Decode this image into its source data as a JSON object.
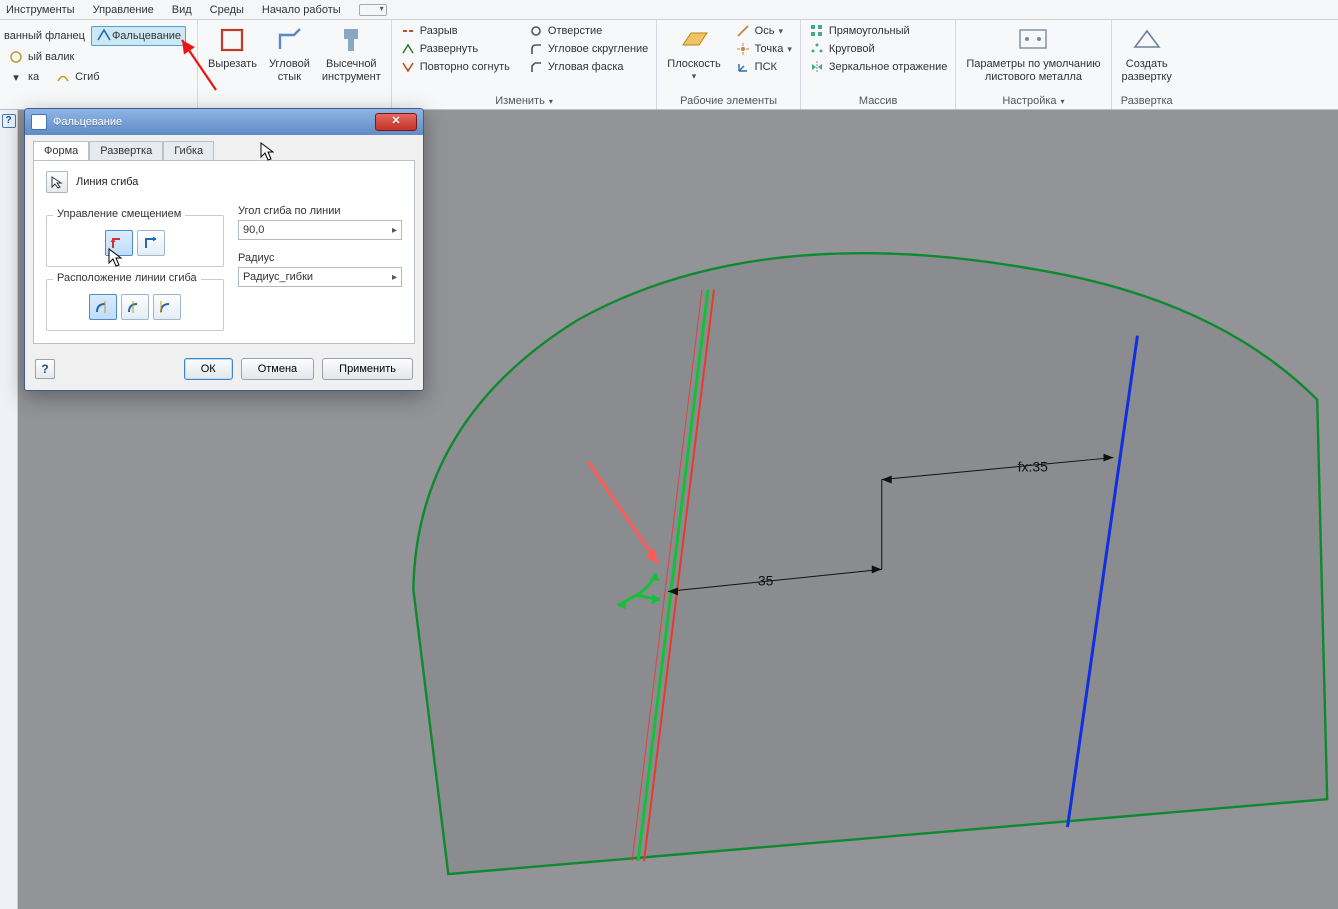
{
  "menu": {
    "items": [
      "Инструменты",
      "Управление",
      "Вид",
      "Среды",
      "Начало работы"
    ]
  },
  "ribbon": {
    "group_left": {
      "btn_flange": "ванный фланец",
      "btn_falc": "Фальцевание",
      "btn_valik": "ый валик",
      "btn_ka": "ка",
      "btn_sgib": "Сгиб"
    },
    "group_cut": {
      "cut": "Вырезать",
      "corner": "Угловой\nстык",
      "punch": "Высечной\nинструмент"
    },
    "group_edit": {
      "rip": "Разрыв",
      "unfold": "Развернуть",
      "refold": "Повторно согнуть",
      "title": "Изменить",
      "hole": "Отверстие",
      "cornerround": "Угловое скругление",
      "cornerchamfer": "Угловая фаска"
    },
    "group_work": {
      "plane": "Плоскость",
      "axis": "Ось",
      "point": "Точка",
      "ucs": "ПСК",
      "title": "Рабочие элементы"
    },
    "group_array": {
      "rect": "Прямоугольный",
      "circ": "Круговой",
      "mirror": "Зеркальное отражение",
      "title": "Массив"
    },
    "group_setup": {
      "defaults": "Параметры по умолчанию\nлистового металла",
      "title": "Настройка"
    },
    "group_flat": {
      "make": "Создать\nразвертку",
      "title": "Развертка"
    }
  },
  "dialog": {
    "title": "Фальцевание",
    "tabs": [
      "Форма",
      "Развертка",
      "Гибка"
    ],
    "bend_line": "Линия сгиба",
    "offset_group": "Управление смещением",
    "pos_group": "Расположение линии сгиба",
    "angle_label": "Угол сгиба по линии",
    "angle_value": "90,0",
    "radius_label": "Радиус",
    "radius_value": "Радиус_гибки",
    "ok": "ОК",
    "cancel": "Отмена",
    "apply": "Применить"
  },
  "canvas": {
    "dim1": "35",
    "dim2": "fx:35"
  }
}
